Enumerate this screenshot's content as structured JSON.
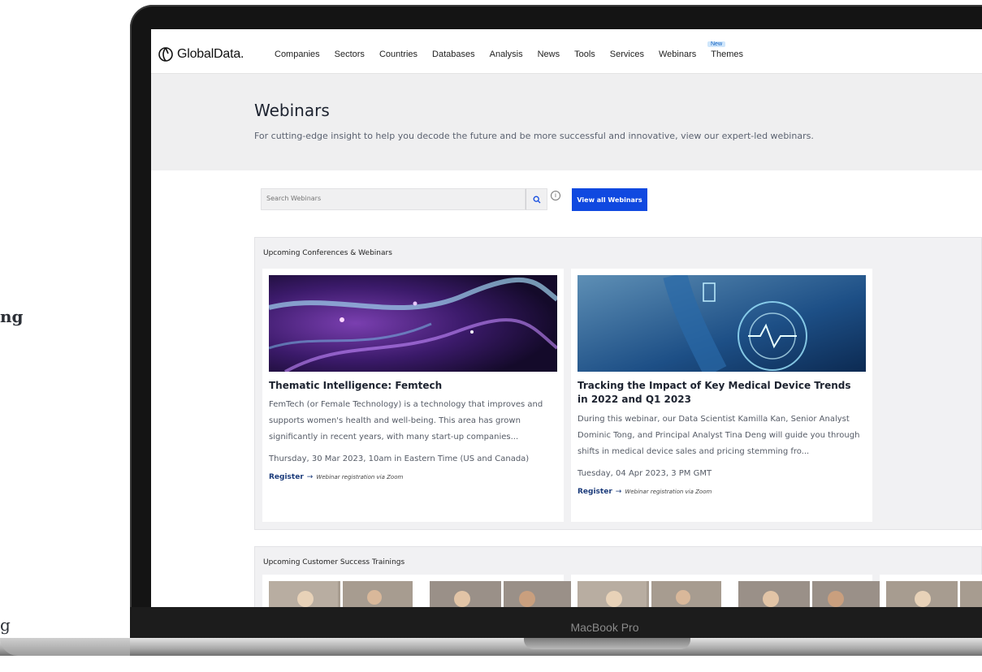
{
  "side_text": {
    "line1": "ng",
    "line2": "g"
  },
  "device_label": "MacBook Pro",
  "nav": {
    "brand": "GlobalData.",
    "items": [
      "Companies",
      "Sectors",
      "Countries",
      "Databases",
      "Analysis",
      "News",
      "Tools",
      "Services",
      "Webinars",
      "Themes"
    ],
    "new_badge": "New"
  },
  "hero": {
    "title": "Webinars",
    "subtitle": "For cutting-edge insight to help you decode the future and be more successful and innovative, view our expert-led webinars."
  },
  "search": {
    "placeholder": "Search Webinars",
    "view_all_label": "View all Webinars",
    "info_glyph": "i"
  },
  "upcoming": {
    "title": "Upcoming Conferences & Webinars",
    "cards": [
      {
        "title": "Thematic Intelligence: Femtech",
        "description": "FemTech (or Female Technology) is a technology that improves and supports women's health and well-being. This area has grown significantly in recent years, with many start-up companies...",
        "date": "Thursday, 30 Mar 2023, 10am in Eastern Time (US and Canada)",
        "register_label": "Register",
        "register_note": "Webinar registration via Zoom"
      },
      {
        "title": "Tracking the Impact of Key Medical Device Trends in 2022 and Q1 2023",
        "description": "During this webinar, our Data Scientist Kamilla Kan, Senior Analyst Dominic Tong, and Principal Analyst Tina Deng will guide you through shifts in medical device sales and pricing stemming fro...",
        "date": "Tuesday, 04 Apr 2023, 3 PM GMT",
        "register_label": "Register",
        "register_note": "Webinar registration via Zoom"
      }
    ]
  },
  "trainings": {
    "title": "Upcoming Customer Success Trainings"
  },
  "colors": {
    "accent": "#1049e0",
    "hero_bg": "#efeff0",
    "section_bg": "#f1f1f3",
    "link": "#1a3a7a"
  },
  "icons": [
    "globaldata-logo-icon",
    "search-icon",
    "info-icon",
    "arrow-right-icon"
  ]
}
